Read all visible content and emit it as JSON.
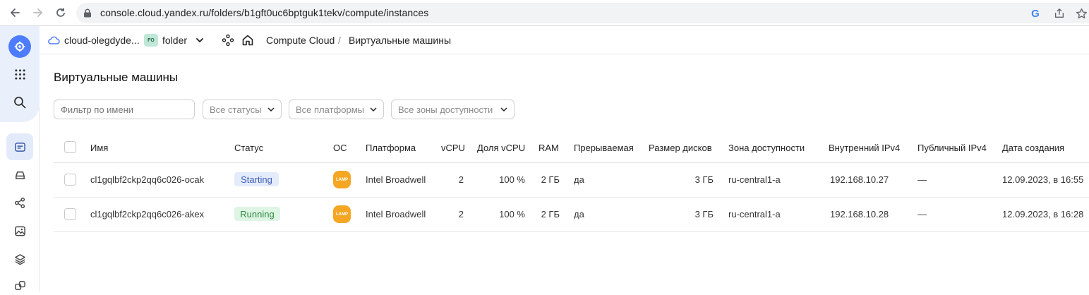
{
  "browser": {
    "url": "console.cloud.yandex.ru/folders/b1gft0uc6bptguk1tekv/compute/instances",
    "google_mark": "G"
  },
  "header": {
    "cloud_name": "cloud-olegdyde...",
    "folder_badge": "FO",
    "folder_name": "folder",
    "breadcrumbs": [
      "Compute Cloud",
      "Виртуальные машины"
    ],
    "separator": "/"
  },
  "main": {
    "title": "Виртуальные машины",
    "filter_placeholder": "Фильтр по имени",
    "status_select": "Все статусы",
    "platform_select": "Все платформы",
    "zone_select": "Все зоны доступности"
  },
  "table": {
    "columns": [
      "Имя",
      "Статус",
      "ОС",
      "Платформа",
      "vCPU",
      "Доля vCPU",
      "RAM",
      "Прерываемая",
      "Размер дисков",
      "Зона доступности",
      "Внутренний IPv4",
      "Публичный IPv4",
      "Дата создания"
    ],
    "rows": [
      {
        "name": "cl1gqlbf2ckp2qq6c026-ocak",
        "status": "Starting",
        "os": "LAMP",
        "platform": "Intel Broadwell",
        "vcpu": "2",
        "vcpu_share": "100 %",
        "ram": "2 ГБ",
        "preemptible": "да",
        "disk": "3 ГБ",
        "zone": "ru-central1-a",
        "internal_ip": "192.168.10.27",
        "public_ip": "—",
        "created": "12.09.2023, в 16:55"
      },
      {
        "name": "cl1gqlbf2ckp2qq6c026-akex",
        "status": "Running",
        "os": "LAMP",
        "platform": "Intel Broadwell",
        "vcpu": "2",
        "vcpu_share": "100 %",
        "ram": "2 ГБ",
        "preemptible": "да",
        "disk": "3 ГБ",
        "zone": "ru-central1-a",
        "internal_ip": "192.168.10.28",
        "public_ip": "—",
        "created": "12.09.2023, в 16:28"
      }
    ]
  },
  "colors": {
    "starting_bg": "#e4ebfb",
    "starting_fg": "#3d5fb8",
    "running_bg": "#dff5e4",
    "running_fg": "#2f8a44",
    "brand_blue": "#4d7cfe",
    "lamp_orange": "#f5a623"
  }
}
